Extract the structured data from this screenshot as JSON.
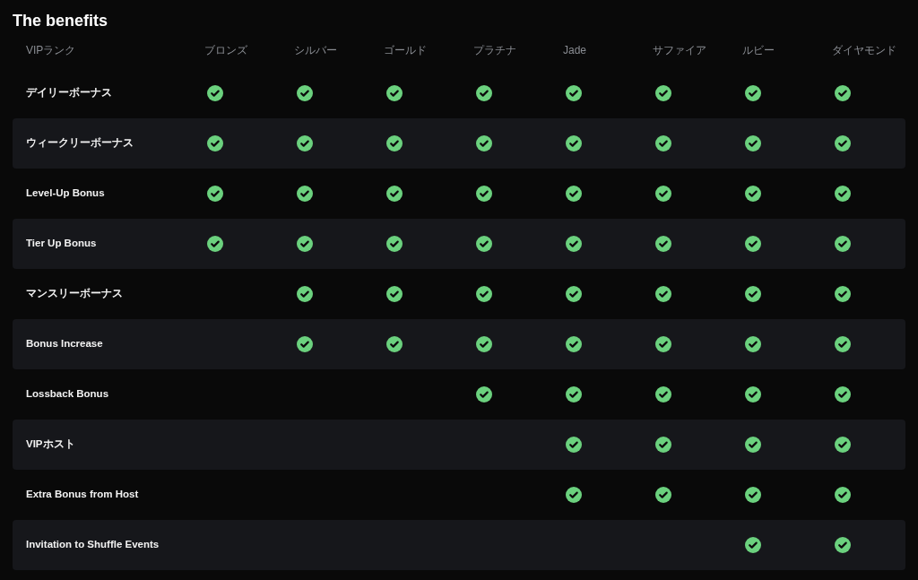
{
  "title": "The benefits",
  "columns": [
    "VIPランク",
    "ブロンズ",
    "シルバー",
    "ゴールド",
    "プラチナ",
    "Jade",
    "サファイア",
    "ルビー",
    "ダイヤモンド"
  ],
  "rows": [
    {
      "label": "デイリーボーナス",
      "checks": [
        true,
        true,
        true,
        true,
        true,
        true,
        true,
        true
      ]
    },
    {
      "label": "ウィークリーボーナス",
      "checks": [
        true,
        true,
        true,
        true,
        true,
        true,
        true,
        true
      ]
    },
    {
      "label": "Level-Up Bonus",
      "checks": [
        true,
        true,
        true,
        true,
        true,
        true,
        true,
        true
      ]
    },
    {
      "label": "Tier Up Bonus",
      "checks": [
        true,
        true,
        true,
        true,
        true,
        true,
        true,
        true
      ]
    },
    {
      "label": "マンスリーボーナス",
      "checks": [
        false,
        true,
        true,
        true,
        true,
        true,
        true,
        true
      ]
    },
    {
      "label": "Bonus Increase",
      "checks": [
        false,
        true,
        true,
        true,
        true,
        true,
        true,
        true
      ]
    },
    {
      "label": "Lossback Bonus",
      "checks": [
        false,
        false,
        false,
        true,
        true,
        true,
        true,
        true
      ]
    },
    {
      "label": "VIPホスト",
      "checks": [
        false,
        false,
        false,
        false,
        true,
        true,
        true,
        true
      ]
    },
    {
      "label": "Extra Bonus from Host",
      "checks": [
        false,
        false,
        false,
        false,
        true,
        true,
        true,
        true
      ]
    },
    {
      "label": "Invitation to Shuffle Events",
      "checks": [
        false,
        false,
        false,
        false,
        false,
        false,
        true,
        true
      ]
    }
  ]
}
